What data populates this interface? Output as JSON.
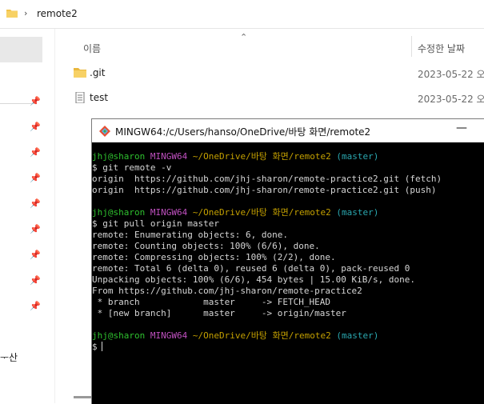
{
  "explorer": {
    "breadcrumb": "remote2",
    "columns": {
      "name": "이름",
      "modified": "수정한 날짜"
    },
    "files": [
      {
        "name": ".git",
        "icon": "folder-icon",
        "date": "2023-05-22 오"
      },
      {
        "name": "test",
        "icon": "text-file-icon",
        "date": "2023-05-22 오"
      }
    ],
    "nav_cut_text": "ᅮ산"
  },
  "terminal": {
    "title": "MINGW64:/c/Users/hanso/OneDrive/바탕 화면/remote2",
    "prompt": {
      "user": "jhj@sharon",
      "sys": "MINGW64",
      "path": "~/OneDrive/바탕 화면/remote2",
      "branch": "(master)"
    },
    "lines": {
      "cmd1": "$ git remote -v",
      "l1": "origin  https://github.com/jhj-sharon/remote-practice2.git (fetch)",
      "l2": "origin  https://github.com/jhj-sharon/remote-practice2.git (push)",
      "cmd2": "$ git pull origin master",
      "l3": "remote: Enumerating objects: 6, done.",
      "l4": "remote: Counting objects: 100% (6/6), done.",
      "l5": "remote: Compressing objects: 100% (2/2), done.",
      "l6": "remote: Total 6 (delta 0), reused 6 (delta 0), pack-reused 0",
      "l7": "Unpacking objects: 100% (6/6), 454 bytes | 15.00 KiB/s, done.",
      "l8": "From https://github.com/jhj-sharon/remote-practice2",
      "l9": " * branch            master     -> FETCH_HEAD",
      "l10": " * [new branch]      master     -> origin/master",
      "cmd3": "$"
    }
  },
  "colors": {
    "prompt_user": "#2ec02e",
    "prompt_sys": "#c050c0",
    "prompt_path": "#c4a000",
    "prompt_branch": "#2aa8b0",
    "terminal_bg": "#000000"
  }
}
